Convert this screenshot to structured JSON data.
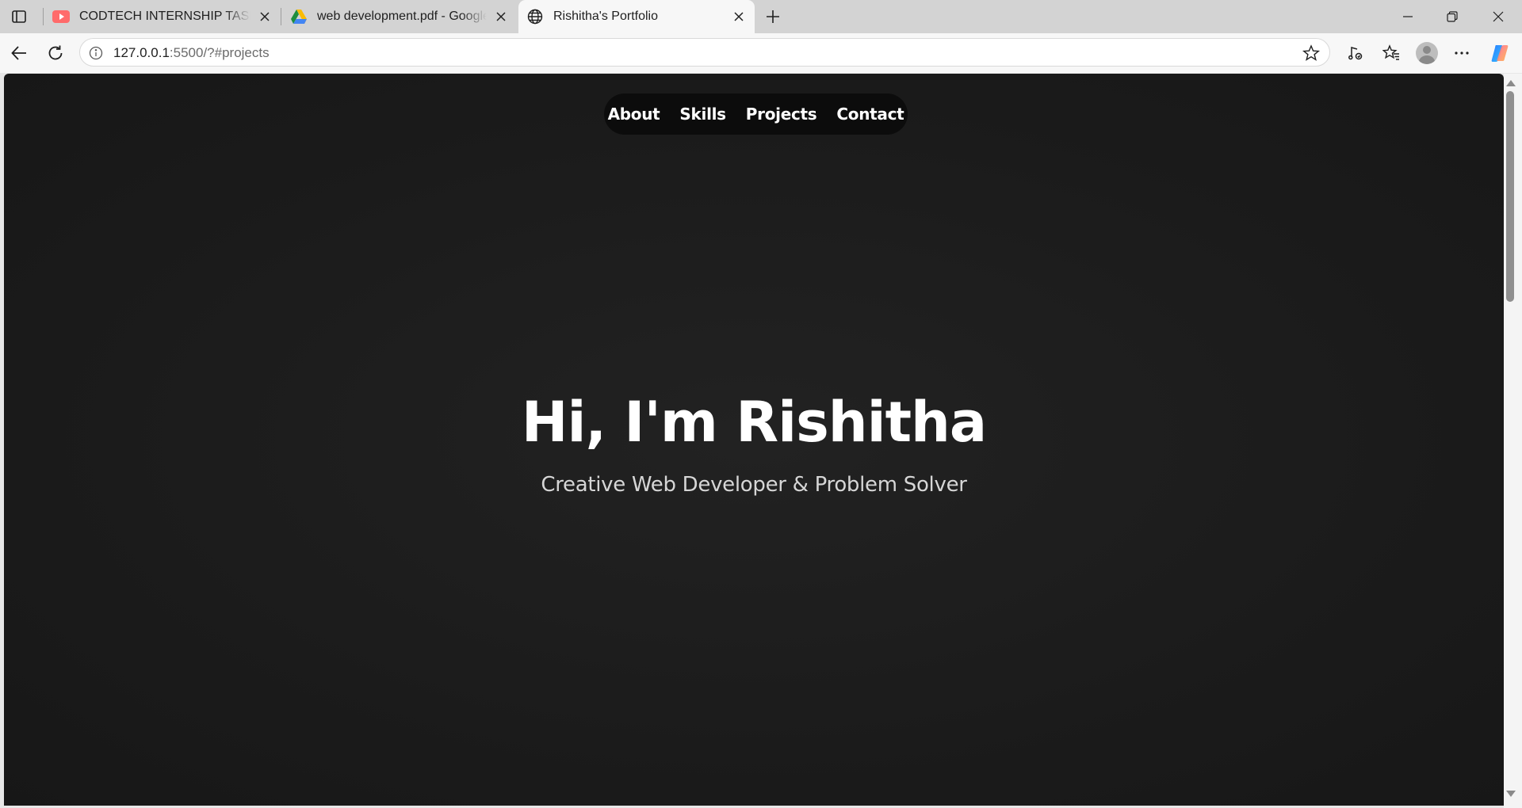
{
  "browser": {
    "tabs": [
      {
        "title": "CODTECH INTERNSHIP TASKS GU",
        "icon": "youtube-icon"
      },
      {
        "title": "web development.pdf - Google D",
        "icon": "google-drive-icon"
      },
      {
        "title": "Rishitha's Portfolio",
        "icon": "globe-icon",
        "active": true
      }
    ],
    "address": {
      "host": "127.0.0.1",
      "rest": ":5500/?#projects"
    }
  },
  "page": {
    "nav": [
      {
        "label": "About"
      },
      {
        "label": "Skills"
      },
      {
        "label": "Projects"
      },
      {
        "label": "Contact"
      }
    ],
    "hero": {
      "title": "Hi, I'm Rishitha",
      "subtitle": "Creative Web Developer & Problem Solver"
    }
  },
  "colors": {
    "page_background": "#1c1c1c",
    "navbar_background": "#0c0c0c",
    "text": "#ffffff",
    "subtitle": "#d6d6d6"
  }
}
